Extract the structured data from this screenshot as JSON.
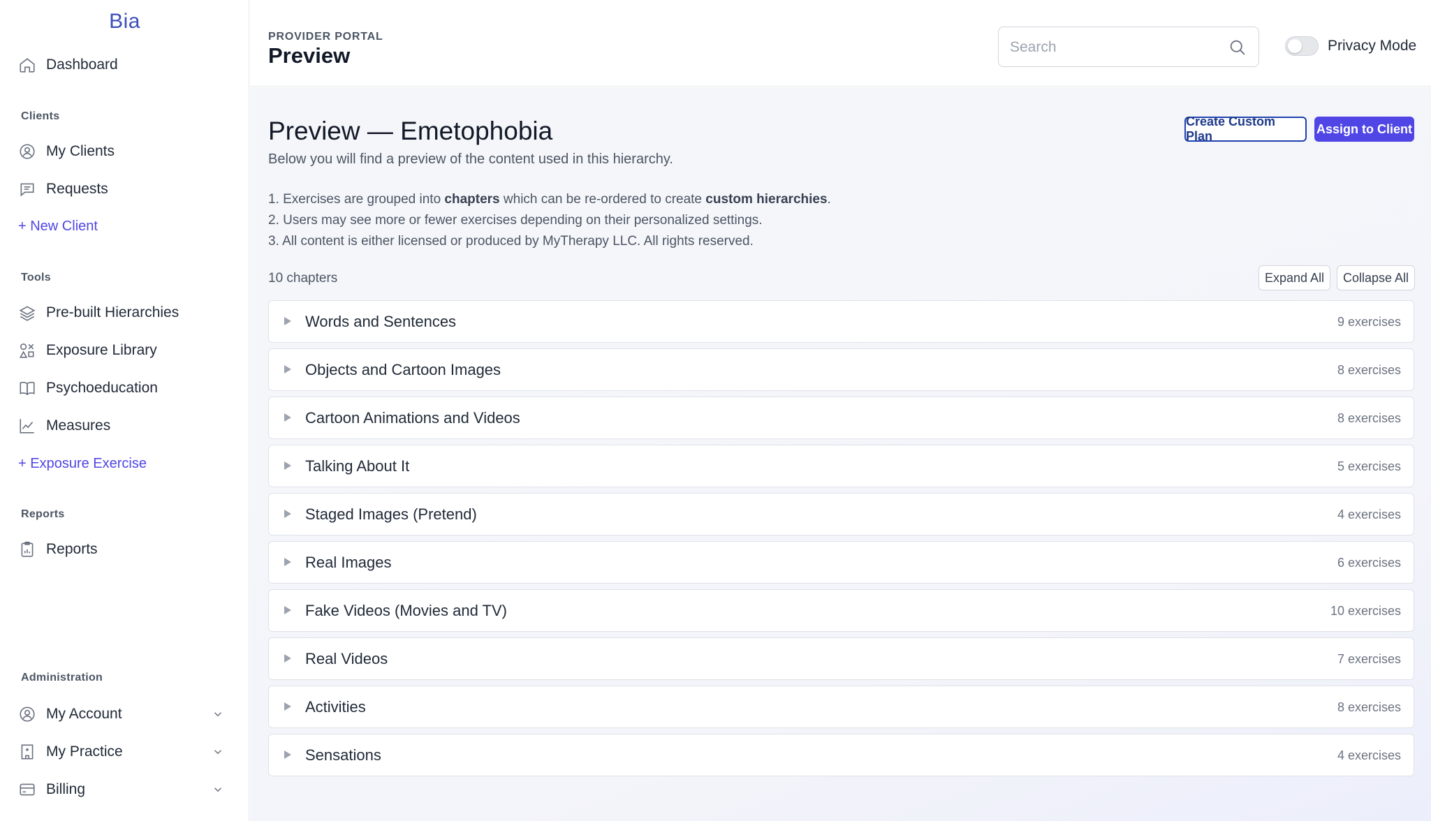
{
  "app": {
    "brand": "Bia"
  },
  "sidebar": {
    "dashboard": "Dashboard",
    "clients_label": "Clients",
    "my_clients": "My Clients",
    "requests": "Requests",
    "new_client": "+ New Client",
    "tools_label": "Tools",
    "prebuilt": "Pre-built Hierarchies",
    "exposure_library": "Exposure Library",
    "psychoeducation": "Psychoeducation",
    "measures": "Measures",
    "new_exercise": "+ Exposure Exercise",
    "reports_label": "Reports",
    "reports": "Reports",
    "admin_label": "Administration",
    "my_account": "My Account",
    "my_practice": "My Practice",
    "billing": "Billing"
  },
  "header": {
    "portal": "PROVIDER PORTAL",
    "title": "Preview",
    "search_placeholder": "Search",
    "search_value": "",
    "privacy_label": "Privacy Mode"
  },
  "main": {
    "heading": "Preview — Emetophobia",
    "subtitle": "Below you will find a preview of the content used in this hierarchy.",
    "note1_a": "1. Exercises are grouped into ",
    "note1_b": "chapters",
    "note1_c": " which can be re-ordered to create ",
    "note1_d": "custom hierarchies",
    "note1_e": ".",
    "note2": "2. Users may see more or fewer exercises depending on their personalized settings.",
    "note3": "3. All content is either licensed or produced by MyTherapy LLC. All rights reserved.",
    "create_custom": "Create Custom Plan",
    "assign": "Assign to Client",
    "chapter_count": "10 chapters",
    "expand_all": "Expand All",
    "collapse_all": "Collapse All",
    "chapters": [
      {
        "name": "Words and Sentences",
        "count": "9 exercises"
      },
      {
        "name": "Objects and Cartoon Images",
        "count": "8 exercises"
      },
      {
        "name": "Cartoon Animations and Videos",
        "count": "8 exercises"
      },
      {
        "name": "Talking About It",
        "count": "5 exercises"
      },
      {
        "name": "Staged Images (Pretend)",
        "count": "4 exercises"
      },
      {
        "name": "Real Images",
        "count": "6 exercises"
      },
      {
        "name": "Fake Videos (Movies and TV)",
        "count": "10 exercises"
      },
      {
        "name": "Real Videos",
        "count": "7 exercises"
      },
      {
        "name": "Activities",
        "count": "8 exercises"
      },
      {
        "name": "Sensations",
        "count": "4 exercises"
      }
    ]
  },
  "colors": {
    "accent": "#4f46e5",
    "brand": "#3b4fb8"
  }
}
